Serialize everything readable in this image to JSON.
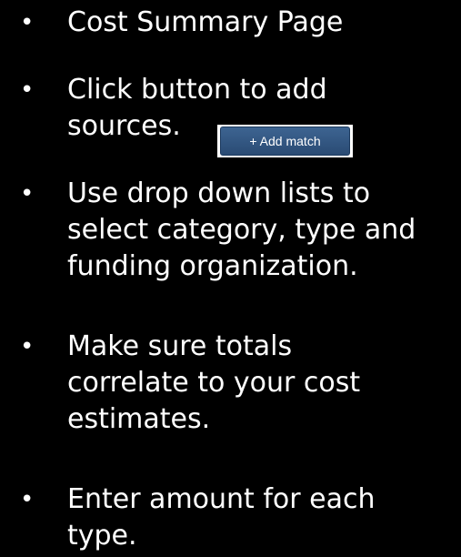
{
  "colors": {
    "background": "#000000",
    "text": "#ffffff",
    "button_bg": "#2f5380",
    "button_text": "#ffffff"
  },
  "bullet_glyph": "•",
  "bullets": [
    {
      "lines": [
        "Cost Summary Page"
      ]
    },
    {
      "lines": [
        "Click   button to add",
        "sources."
      ]
    },
    {
      "lines": [
        "Use drop down lists to",
        "select category, type and",
        "funding organization."
      ]
    },
    {
      "lines": [
        "Make sure totals",
        "correlate to your cost",
        "estimates."
      ]
    },
    {
      "lines": [
        "Enter amount for each",
        "type."
      ]
    }
  ],
  "add_match_button": {
    "label": "+ Add match"
  }
}
